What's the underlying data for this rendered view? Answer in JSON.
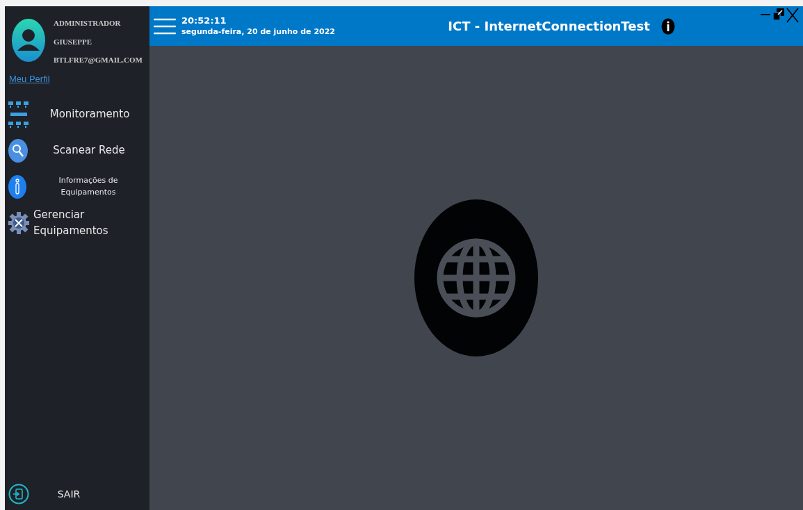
{
  "user": {
    "role": "ADMINISTRADOR",
    "name": "GIUSEPPE",
    "email": "BTLFRE7@GMAIL.COM",
    "profile_link": "Meu Perfil"
  },
  "menu": [
    {
      "kind": "network",
      "label": "Monitoramento"
    },
    {
      "kind": "search",
      "label": "Scanear Rede"
    },
    {
      "kind": "info",
      "label": "Informações de Equipamentos"
    },
    {
      "kind": "gear",
      "label": "Gerenciar Equipamentos"
    }
  ],
  "logout": {
    "label": "SAIR"
  },
  "header": {
    "time": "20:52:11",
    "date": "segunda-feira, 20 de junho de 2022",
    "title": "ICT - InternetConnectionTest"
  }
}
